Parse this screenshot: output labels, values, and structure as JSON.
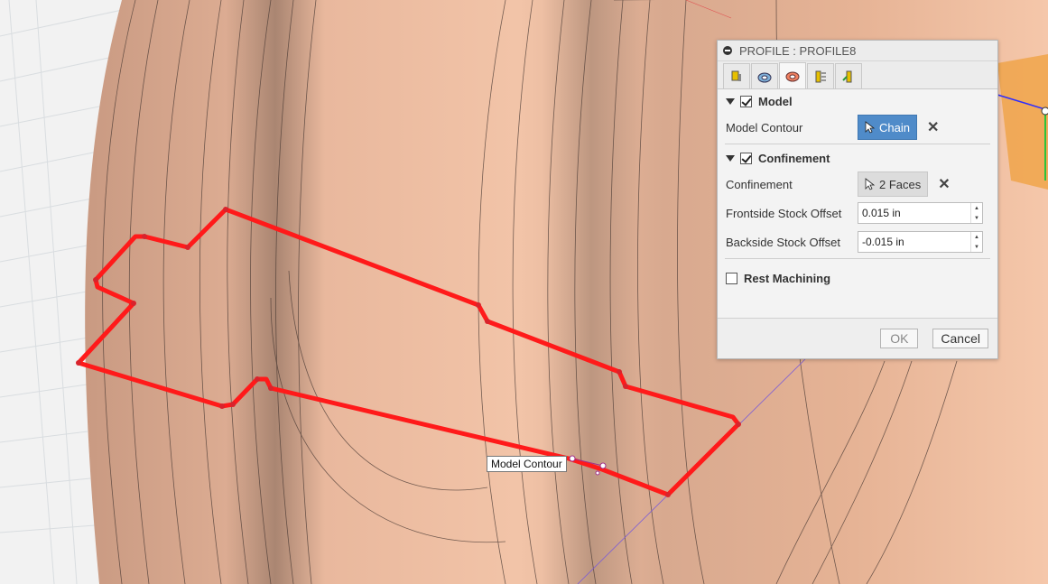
{
  "tooltip": "Model Contour",
  "dialog": {
    "title": "PROFILE : PROFILE8",
    "tabs": [
      {
        "icon": "tool-tab-icon"
      },
      {
        "icon": "geometry-tab-icon"
      },
      {
        "icon": "heights-tab-icon"
      },
      {
        "icon": "passes-tab-icon"
      },
      {
        "icon": "linking-tab-icon"
      }
    ],
    "model": {
      "heading": "Model",
      "checked": true,
      "contour_label": "Model Contour",
      "chain_button": "Chain"
    },
    "confinement": {
      "heading": "Confinement",
      "checked": true,
      "label": "Confinement",
      "faces_button": "2 Faces",
      "frontside_label": "Frontside Stock Offset",
      "frontside_value": "0.015 in",
      "backside_label": "Backside Stock Offset",
      "backside_value": "-0.015 in"
    },
    "rest_machining": {
      "label": "Rest Machining",
      "checked": false
    },
    "ok_label": "OK",
    "cancel_label": "Cancel"
  },
  "colors": {
    "contour": "#ff1a1a",
    "part": "#e8b89d",
    "chain_active": "#4f8bc9"
  }
}
